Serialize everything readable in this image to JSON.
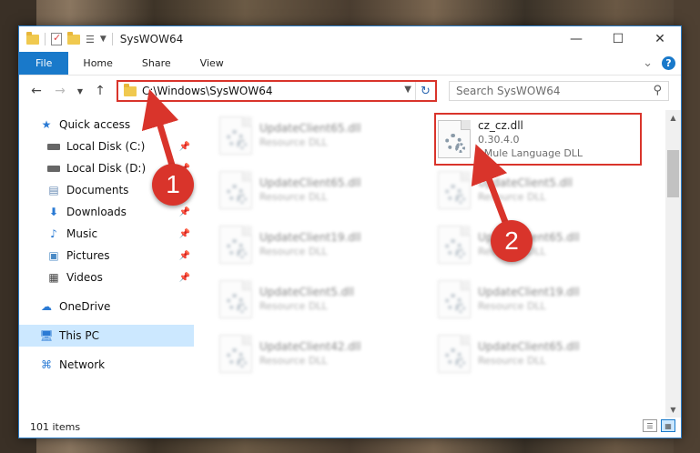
{
  "window": {
    "title": "SysWOW64",
    "controls": {
      "minimize": "—",
      "maximize": "☐",
      "close": "✕"
    }
  },
  "ribbon": {
    "tabs": [
      "File",
      "Home",
      "Share",
      "View"
    ],
    "expand_glyph": "⌄",
    "help_glyph": "?"
  },
  "address": {
    "path": "C:\\Windows\\SysWOW64",
    "search_placeholder": "Search SysWOW64"
  },
  "nav": {
    "items": [
      {
        "label": "Quick access",
        "icon": "star-icon",
        "pinned": false
      },
      {
        "label": "Local Disk (C:)",
        "icon": "drive-icon",
        "pinned": true
      },
      {
        "label": "Local Disk (D:)",
        "icon": "drive-icon",
        "pinned": true
      },
      {
        "label": "Documents",
        "icon": "documents-icon",
        "pinned": true
      },
      {
        "label": "Downloads",
        "icon": "download-icon",
        "pinned": true
      },
      {
        "label": "Music",
        "icon": "music-icon",
        "pinned": true
      },
      {
        "label": "Pictures",
        "icon": "pictures-icon",
        "pinned": true
      },
      {
        "label": "Videos",
        "icon": "videos-icon",
        "pinned": true
      },
      {
        "label": "OneDrive",
        "icon": "cloud-icon",
        "pinned": false
      },
      {
        "label": "This PC",
        "icon": "computer-icon",
        "pinned": false,
        "selected": true
      },
      {
        "label": "Network",
        "icon": "network-icon",
        "pinned": false
      }
    ]
  },
  "files": {
    "left_column": [
      {
        "name": "UpdateClient65.dll",
        "type": "Resource DLL"
      },
      {
        "name": "UpdateClient65.dll",
        "type": "Resource DLL"
      },
      {
        "name": "UpdateClient19.dll",
        "type": "Resource DLL"
      },
      {
        "name": "UpdateClient5.dll",
        "type": "Resource DLL"
      },
      {
        "name": "UpdateClient42.dll",
        "type": "Resource DLL"
      }
    ],
    "right_column": [
      {
        "name": "cz_cz.dll",
        "version": "0.30.4.0",
        "type": "eMule Language DLL",
        "highlighted": true
      },
      {
        "name": "UpdateClient5.dll",
        "type": "Resource DLL"
      },
      {
        "name": "UpdateClient65.dll",
        "type": "Resource DLL"
      },
      {
        "name": "UpdateClient19.dll",
        "type": "Resource DLL"
      },
      {
        "name": "UpdateClient65.dll",
        "type": "Resource DLL"
      }
    ]
  },
  "status": {
    "item_count": "101 items"
  },
  "annotations": {
    "step1": "1",
    "step2": "2",
    "color": "#d9342b"
  }
}
